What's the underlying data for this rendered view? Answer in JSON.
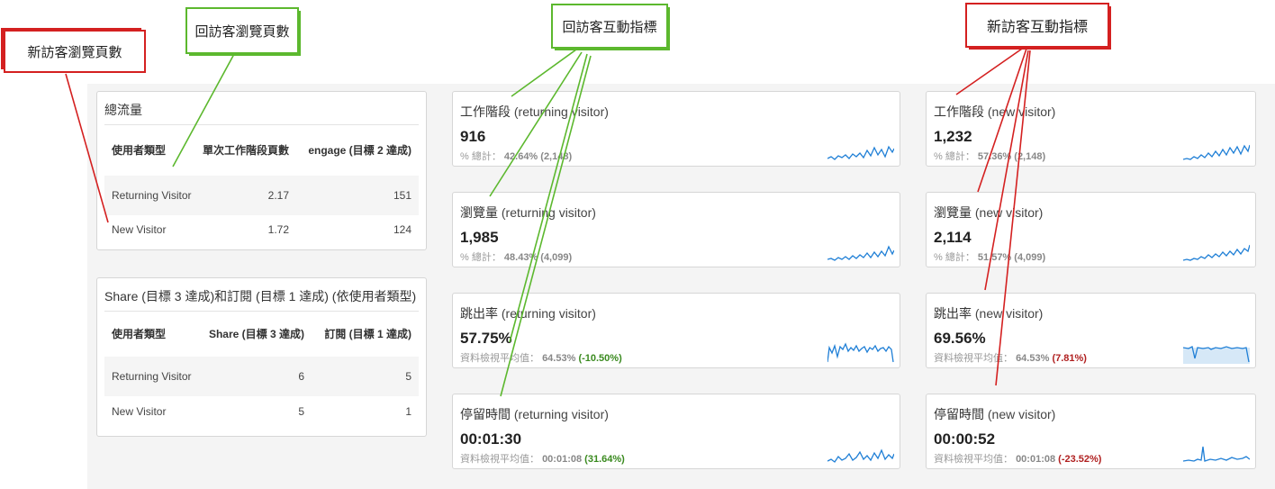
{
  "tables": [
    {
      "title": "總流量",
      "headers": [
        "使用者類型",
        "單次工作階段頁數",
        "engage (目標 2 達成)"
      ],
      "rows": [
        [
          "Returning Visitor",
          "2.17",
          "151"
        ],
        [
          "New Visitor",
          "1.72",
          "124"
        ]
      ]
    },
    {
      "title": "Share (目標 3 達成)和訂閱 (目標 1 達成) (依使用者類型)",
      "headers": [
        "使用者類型",
        "Share (目標 3 達成)",
        "訂閱 (目標 1 達成)"
      ],
      "rows": [
        [
          "Returning Visitor",
          "6",
          "5"
        ],
        [
          "New Visitor",
          "5",
          "1"
        ]
      ]
    }
  ],
  "returning_metrics": [
    {
      "label": "工作階段",
      "segment": "(returning visitor)",
      "value": "916",
      "foot_label": "% 總計：",
      "foot_pct": "42.64%",
      "foot_base": "(2,148)",
      "foot_diff": ""
    },
    {
      "label": "瀏覽量",
      "segment": "(returning visitor)",
      "value": "1,985",
      "foot_label": "% 總計：",
      "foot_pct": "48.43%",
      "foot_base": "(4,099)",
      "foot_diff": ""
    },
    {
      "label": "跳出率",
      "segment": "(returning visitor)",
      "value": "57.75%",
      "foot_label": "資料檢視平均值：",
      "foot_pct": "64.53%",
      "foot_base": "",
      "foot_diff": "(-10.50%)"
    },
    {
      "label": "停留時間",
      "segment": "(returning visitor)",
      "value": "00:01:30",
      "foot_label": "資料檢視平均值：",
      "foot_pct": "00:01:08",
      "foot_base": "",
      "foot_diff": "(31.64%)"
    }
  ],
  "new_metrics": [
    {
      "label": "工作階段",
      "segment": "(new visitor)",
      "value": "1,232",
      "foot_label": "% 總計：",
      "foot_pct": "57.36%",
      "foot_base": "(2,148)",
      "foot_diff": ""
    },
    {
      "label": "瀏覽量",
      "segment": "(new visitor)",
      "value": "2,114",
      "foot_label": "% 總計：",
      "foot_pct": "51.57%",
      "foot_base": "(4,099)",
      "foot_diff": ""
    },
    {
      "label": "跳出率",
      "segment": "(new visitor)",
      "value": "69.56%",
      "foot_label": "資料檢視平均值：",
      "foot_pct": "64.53%",
      "foot_base": "",
      "foot_diff": "(7.81%)"
    },
    {
      "label": "停留時間",
      "segment": "(new visitor)",
      "value": "00:00:52",
      "foot_label": "資料檢視平均值：",
      "foot_pct": "00:01:08",
      "foot_base": "",
      "foot_diff": "(-23.52%)"
    }
  ],
  "callouts": {
    "new_pageviews": "新訪客瀏覽頁數",
    "returning_pageviews": "回訪客瀏覽頁數",
    "returning_engagement": "回訪客互動指標",
    "new_engagement": "新訪客互動指標"
  },
  "colors": {
    "green_note": "#5cb82e",
    "red_note": "#d42020",
    "sparkline": "#1f7fd6",
    "positive": "#3a8a1f",
    "negative": "#b02020"
  }
}
